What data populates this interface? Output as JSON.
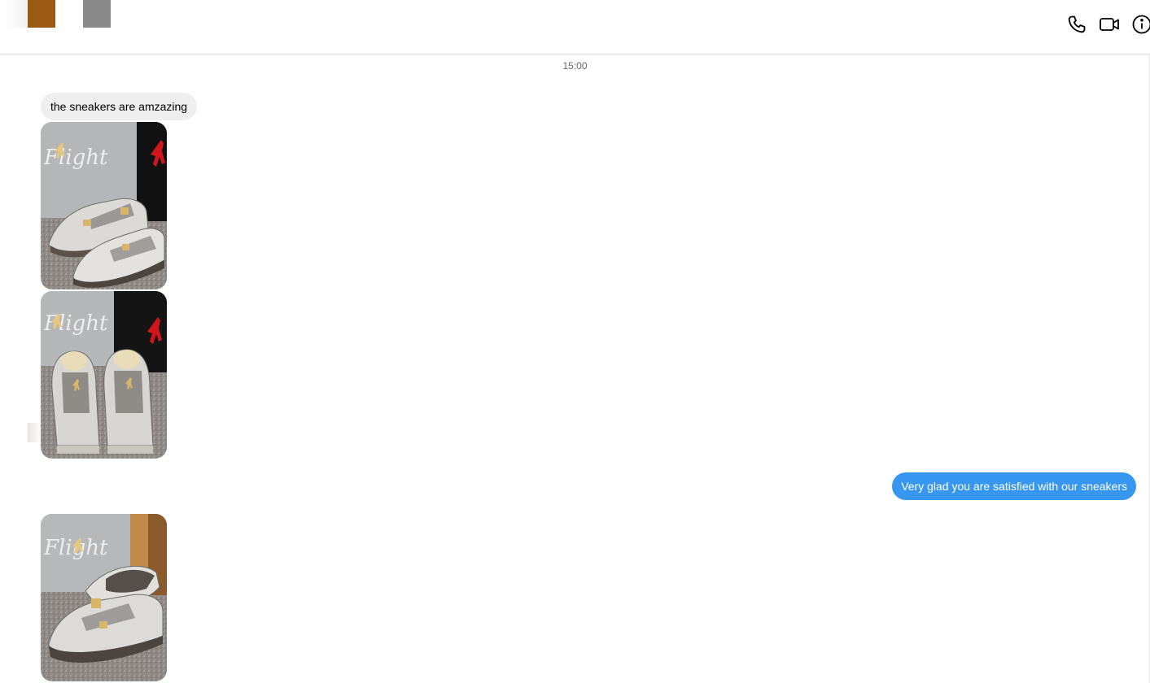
{
  "header": {
    "call_icon": "phone-icon",
    "video_icon": "video-camera-icon",
    "info_icon": "info-icon"
  },
  "thread": {
    "timestamp": "15:00",
    "incoming_message": "the sneakers are amzazing",
    "outgoing_message": "Very glad you are satisfied with our sneakers"
  },
  "photos": {
    "logo_text": "Flight"
  },
  "colors": {
    "outgoing_bubble": "#3797f0",
    "incoming_bubble": "#efefef",
    "divider": "#dbdbdb"
  }
}
